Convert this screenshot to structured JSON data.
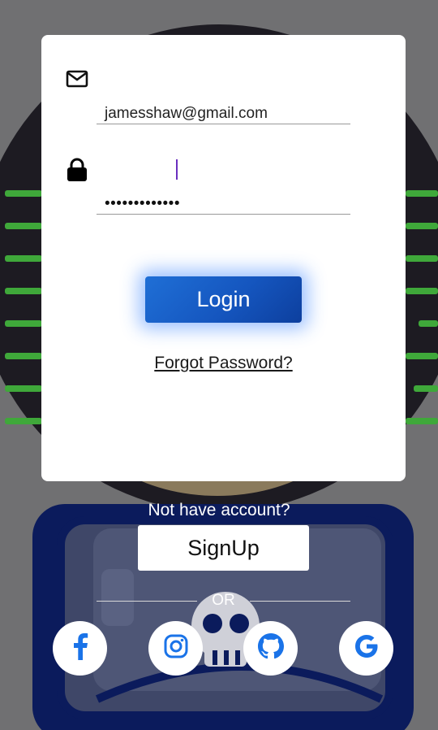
{
  "login_card": {
    "email_value": "jamesshaw@gmail.com",
    "password_value": "•••••••••••••",
    "login_label": "Login",
    "forgot_label": "Forgot Password?"
  },
  "signup": {
    "prompt": "Not have account?",
    "button_label": "SignUp",
    "or_label": "OR"
  },
  "social": [
    {
      "icon": "facebook-icon"
    },
    {
      "icon": "instagram-icon"
    },
    {
      "icon": "github-icon"
    },
    {
      "icon": "google-icon"
    }
  ],
  "colors": {
    "accent": "#1565c0",
    "social_icon": "#1a73e8",
    "caret": "#6a2fbf"
  }
}
